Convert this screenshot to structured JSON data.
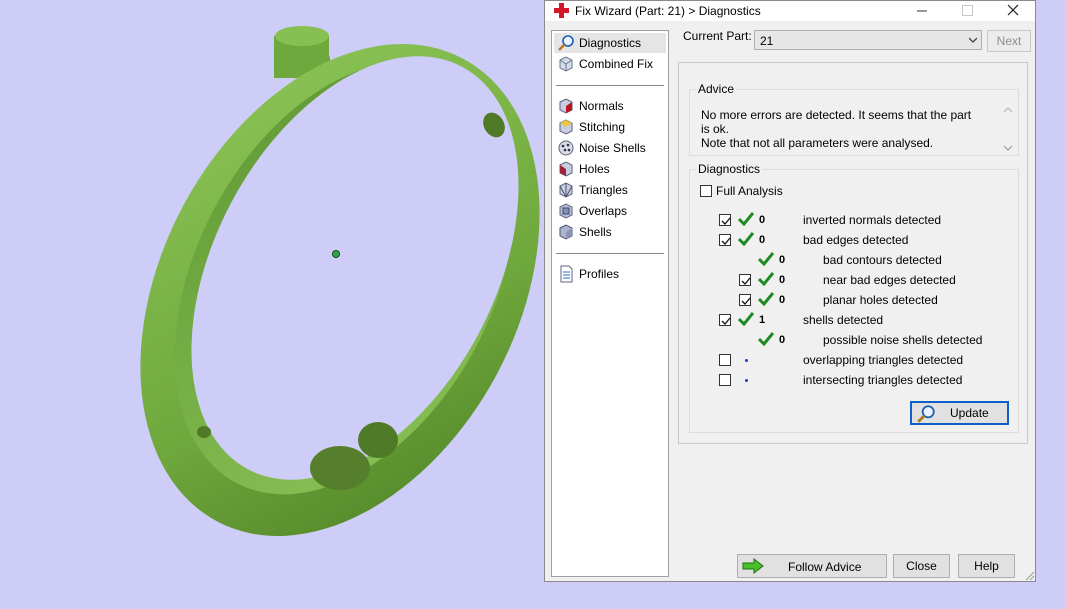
{
  "window": {
    "title": "Fix Wizard (Part: 21) > Diagnostics",
    "icon": "red-cross-icon"
  },
  "nav": {
    "items": [
      {
        "label": "Diagnostics",
        "icon": "magnifier-icon",
        "selected": true
      },
      {
        "label": "Combined Fix",
        "icon": "combined-fix-icon"
      },
      {
        "label": "Normals",
        "icon": "normals-icon"
      },
      {
        "label": "Stitching",
        "icon": "stitching-icon"
      },
      {
        "label": "Noise Shells",
        "icon": "noise-shells-icon"
      },
      {
        "label": "Holes",
        "icon": "holes-icon"
      },
      {
        "label": "Triangles",
        "icon": "triangles-icon"
      },
      {
        "label": "Overlaps",
        "icon": "overlaps-icon"
      },
      {
        "label": "Shells",
        "icon": "shells-icon"
      },
      {
        "label": "Profiles",
        "icon": "document-icon"
      }
    ]
  },
  "top": {
    "current_part_label": "Current Part:",
    "current_part_value": "21",
    "next_label": "Next"
  },
  "advice": {
    "title": "Advice",
    "line1": "No more errors are detected. It seems that the part is ok.",
    "line2": "Note that not all parameters were analysed."
  },
  "diagnostics": {
    "title": "Diagnostics",
    "full_analysis_label": "Full Analysis",
    "full_analysis_checked": false,
    "rows": [
      {
        "checked": true,
        "status": "ok",
        "count": "0",
        "label": "inverted normals detected"
      },
      {
        "checked": true,
        "status": "ok",
        "count": "0",
        "label": "bad edges detected"
      },
      {
        "status": "ok",
        "count": "0",
        "label": "bad contours detected"
      },
      {
        "checked": true,
        "status": "ok",
        "count": "0",
        "label": "near bad edges detected"
      },
      {
        "checked": true,
        "status": "ok",
        "count": "0",
        "label": "planar holes detected"
      },
      {
        "checked": true,
        "status": "ok",
        "count": "1",
        "label": "shells detected"
      },
      {
        "status": "ok",
        "count": "0",
        "label": "possible noise shells detected"
      },
      {
        "checked": false,
        "status": "none",
        "label": "overlapping triangles detected"
      },
      {
        "checked": false,
        "status": "none",
        "label": "intersecting triangles detected"
      }
    ],
    "update_label": "Update"
  },
  "footer": {
    "follow_advice_label": "Follow Advice",
    "close_label": "Close",
    "help_label": "Help"
  },
  "colors": {
    "viewport_bg": "#cdcdf8",
    "part_green": "#7db24a",
    "check_green": "#1f8a24",
    "accent_blue": "#0b61c8"
  }
}
